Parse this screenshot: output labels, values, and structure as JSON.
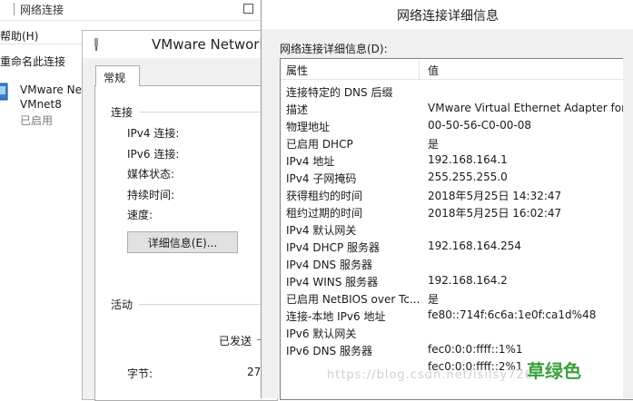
{
  "explorer": {
    "title": "网络连接",
    "menu_help": "帮助(H)",
    "toolbar_rename": "重命名此连接",
    "adapter": {
      "name_line1": "VMware Ne",
      "name_line2": "VMnet8",
      "status": "已启用"
    }
  },
  "status_dialog": {
    "title": "VMware Network",
    "tab_general": "常规",
    "group_connection": "连接",
    "fields": {
      "ipv4": "IPv4 连接:",
      "ipv6": "IPv6 连接:",
      "media": "媒体状态:",
      "duration": "持续时间:",
      "speed": "速度:"
    },
    "details_button": "详细信息(E)...",
    "group_activity": "活动",
    "sent_label": "已发送",
    "bytes_label": "字节:",
    "bytes_value": "27"
  },
  "details_dialog": {
    "title": "网络连接详细信息",
    "caption": "网络连接详细信息(D):",
    "columns": {
      "property": "属性",
      "value": "值"
    },
    "rows": [
      {
        "p": "连接特定的 DNS 后缀",
        "v": ""
      },
      {
        "p": "描述",
        "v": "VMware Virtual Ethernet Adapter for"
      },
      {
        "p": "物理地址",
        "v": "00-50-56-C0-00-08"
      },
      {
        "p": "已启用 DHCP",
        "v": "是"
      },
      {
        "p": "IPv4 地址",
        "v": "192.168.164.1"
      },
      {
        "p": "IPv4 子网掩码",
        "v": "255.255.255.0"
      },
      {
        "p": "获得租约的时间",
        "v": "2018年5月25日 14:32:47"
      },
      {
        "p": "租约过期的时间",
        "v": "2018年5月25日 16:02:47"
      },
      {
        "p": "IPv4 默认网关",
        "v": ""
      },
      {
        "p": "IPv4 DHCP 服务器",
        "v": "192.168.164.254"
      },
      {
        "p": "IPv4 DNS 服务器",
        "v": ""
      },
      {
        "p": "IPv4 WINS 服务器",
        "v": "192.168.164.2"
      },
      {
        "p": "已启用 NetBIOS over Tc...",
        "v": "是"
      },
      {
        "p": "连接-本地 IPv6 地址",
        "v": "fe80::714f:6c6a:1e0f:ca1d%48"
      },
      {
        "p": "IPv6 默认网关",
        "v": ""
      },
      {
        "p": "IPv6 DNS 服务器",
        "v": "fec0:0:0:ffff::1%1"
      },
      {
        "p": "",
        "v": "fec0:0:0:ffff::2%1"
      }
    ]
  },
  "watermark": {
    "url": "https://blog.csdn.net/isilsy726",
    "label": "草绿色"
  },
  "colors": {
    "dialog_bg": "#f0f0f0",
    "watermark_green": "#3aa13a"
  }
}
